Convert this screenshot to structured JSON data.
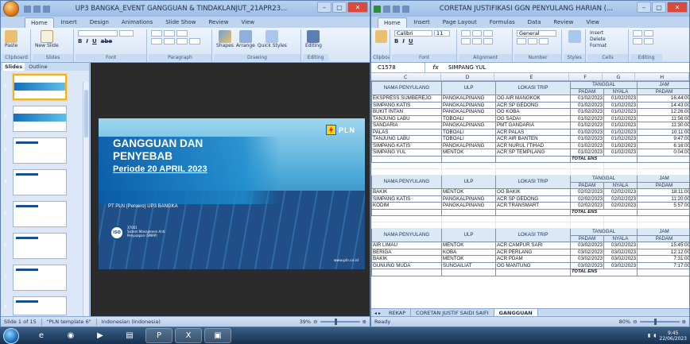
{
  "ppt": {
    "title": "UP3 BANGKA_EVENT GANGGUAN & TINDAKLANJUT_21APR23...",
    "tabs": [
      "Home",
      "Insert",
      "Design",
      "Animations",
      "Slide Show",
      "Review",
      "View"
    ],
    "ribbon_groups": [
      "Clipboard",
      "Slides",
      "Font",
      "Paragraph",
      "Drawing",
      "Editing"
    ],
    "buttons": {
      "paste": "Paste",
      "new_slide": "New Slide",
      "shapes": "Shapes",
      "arrange": "Arrange",
      "quick_styles": "Quick Styles",
      "editing": "Editing"
    },
    "panel_tabs": [
      "Slides",
      "Outline"
    ],
    "slide_numbers": [
      "1",
      "2",
      "3",
      "4",
      "5",
      "6",
      "7",
      "8"
    ],
    "slide": {
      "title_line1": "GANGGUAN DAN",
      "title_line2": "PENYEBAB",
      "period": "Periode 20 APRIL 2023",
      "brand": "PLN",
      "company": "PT PLN (Persero) UP3 BANGKA",
      "iso": "ISO",
      "iso_num": "37001",
      "iso_text": "Sistem Manajemen Anti Penyuapan (SMAP)",
      "web": "www.pln.co.id"
    },
    "status": {
      "slide": "Slide 1 of 15",
      "template": "\"PLN template 6\"",
      "language": "Indonesian (Indonesia)",
      "zoom": "39%"
    }
  },
  "xl": {
    "title": "CORETAN JUSTIFIKASI GGN PENYULANG HARIAN (...",
    "tabs": [
      "Home",
      "Insert",
      "Page Layout",
      "Formulas",
      "Data",
      "Review",
      "View"
    ],
    "ribbon_groups": [
      "Clipboard",
      "Font",
      "Alignment",
      "Number",
      "Styles",
      "Cells",
      "Editing"
    ],
    "font_name": "Calibri",
    "font_size": "11",
    "number_format": "General",
    "cells_buttons": {
      "insert": "Insert",
      "delete": "Delete",
      "format": "Format"
    },
    "name_box": "C1578",
    "formula": "SIMPANG YUL",
    "columns": [
      "C",
      "D",
      "E",
      "F",
      "G",
      "H"
    ],
    "headers": {
      "penyulang": "NAMA PENYULANG",
      "ulp": "ULP",
      "lokasi": "LOKASI TRIP",
      "tanggal": "TANGGAL",
      "jam": "JAM",
      "padam": "PADAM",
      "nyala": "NYALA"
    },
    "blocks": [
      {
        "rows": [
          [
            "EKSPRESS SUMBEREJO",
            "PANGKALPINANG",
            "OG AIR MANGKOK",
            "01/02/2023",
            "01/02/2023",
            "16:44:00"
          ],
          [
            "SIMPANG KATIS",
            "PANGKALPINANG",
            "ACR SP GEDONG",
            "01/02/2023",
            "01/02/2023",
            "14:43:00"
          ],
          [
            "BUKIT INTAN",
            "PANGKALPINANG",
            "OG KOBA",
            "01/02/2023",
            "01/02/2023",
            "12:26:00"
          ],
          [
            "TANJUNG LABU",
            "TOBOALI",
            "OG SADAI",
            "01/02/2023",
            "01/02/2023",
            "11:56:00"
          ],
          [
            "SANDARIA",
            "PANGKALPINANG",
            "PMT GANDARIA",
            "01/02/2023",
            "01/02/2023",
            "11:30:00"
          ],
          [
            "PALAS",
            "TOBOALI",
            "ACR PALAS",
            "01/02/2023",
            "01/02/2023",
            "10:11:00"
          ],
          [
            "TANJUNG LABU",
            "TOBOALI",
            "ACR AIR BANTEN",
            "01/02/2023",
            "01/02/2023",
            "9:47:00"
          ],
          [
            "SIMPANG KATIS",
            "PANGKALPINANG",
            "ACR NURUL I'TIHAD",
            "01/02/2023",
            "01/02/2023",
            "6:16:00"
          ],
          [
            "SIMPANG YUL",
            "MENTOK",
            "ACR SP TEMPILANG",
            "01/02/2023",
            "01/02/2023",
            "0:04:00"
          ]
        ],
        "total": "TOTAL ENS"
      },
      {
        "rows": [
          [
            "BAKIK",
            "MENTOK",
            "OG BAKIK",
            "02/02/2023",
            "02/02/2023",
            "18:11:00"
          ],
          [
            "SIMPANG KATIS",
            "PANGKALPINANG",
            "ACR SP GEDONG",
            "02/02/2023",
            "02/02/2023",
            "11:20:00"
          ],
          [
            "KODIM",
            "PANGKALPINANG",
            "ACR TRANSMART",
            "02/02/2023",
            "02/02/2023",
            "5:57:00"
          ]
        ],
        "total": "TOTAL ENS"
      },
      {
        "rows": [
          [
            "AIR LIMAU",
            "MENTOK",
            "ACR CAMPUR SARI",
            "03/02/2023",
            "03/02/2023",
            "15:45:00"
          ],
          [
            "BERIGA",
            "KOBA",
            "ACR PERLANG",
            "03/02/2023",
            "03/02/2023",
            "12:12:00"
          ],
          [
            "BAKIK",
            "MENTOK",
            "ACR PDAM",
            "03/02/2023",
            "03/02/2023",
            "7:31:00"
          ],
          [
            "GUNUNG MUDA",
            "SUNGAILIAT",
            "OG MANTUNG",
            "03/02/2023",
            "03/02/2023",
            "7:17:00"
          ]
        ],
        "total": "TOTAL ENS"
      }
    ],
    "sheet_tabs": [
      "REKAP",
      "CORETAN JUSTIF SAIDI SAIFI",
      "GANGGUAN"
    ],
    "status": {
      "ready": "Ready",
      "zoom": "80%"
    }
  },
  "taskbar": {
    "clock_time": "9:45",
    "clock_date": "22/06/2023"
  }
}
